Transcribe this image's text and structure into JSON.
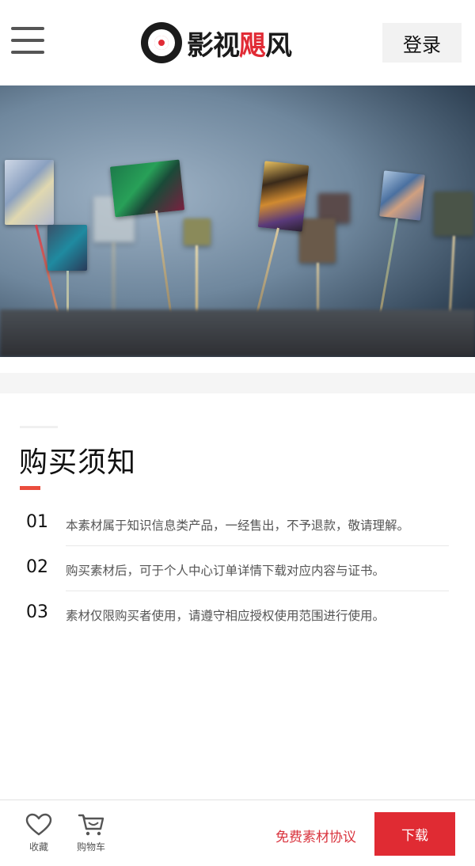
{
  "header": {
    "logo_text_a": "影视",
    "logo_text_b": "飓",
    "logo_text_c": "风",
    "login_label": "登录",
    "menu_icon": "hamburger-menu-icon"
  },
  "hero": {
    "image_subject": "microchips-on-pins-photo"
  },
  "notice": {
    "title": "购买须知",
    "accent_color": "#ea4d3d",
    "items": [
      {
        "num": "01",
        "text": "本素材属于知识信息类产品，一经售出，不予退款，敬请理解。"
      },
      {
        "num": "02",
        "text": "购买素材后，可于个人中心订单详情下载对应内容与证书。"
      },
      {
        "num": "03",
        "text": "素材仅限购买者使用，请遵守相应授权使用范围进行使用。"
      }
    ]
  },
  "bottom_bar": {
    "favorite_label": "收藏",
    "favorite_icon": "heart-icon",
    "cart_label": "购物车",
    "cart_icon": "cart-icon",
    "agreement_label": "免费素材协议",
    "download_label": "下载",
    "brand_color": "#e02b33"
  }
}
